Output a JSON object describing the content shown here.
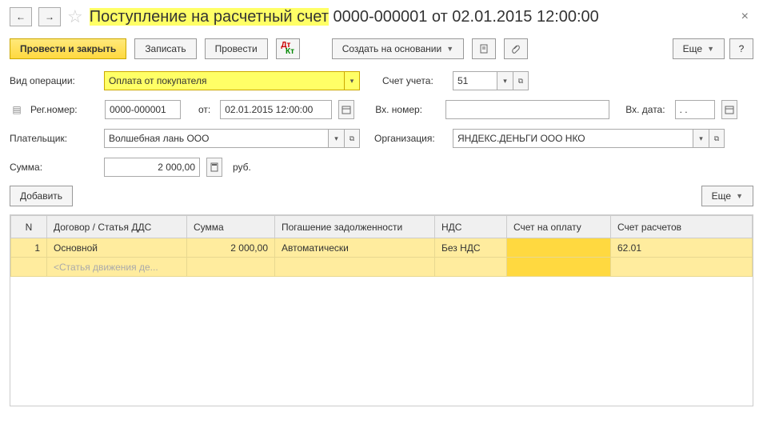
{
  "header": {
    "title_hl": "Поступление на расчетный счет",
    "title_rest": " 0000-000001 от 02.01.2015 12:00:00"
  },
  "toolbar": {
    "post_close": "Провести и закрыть",
    "save": "Записать",
    "post": "Провести",
    "create_based": "Создать на основании",
    "more": "Еще",
    "help": "?"
  },
  "fields": {
    "op_type_lbl": "Вид операции:",
    "op_type_val": "Оплата от покупателя",
    "account_lbl": "Счет учета:",
    "account_val": "51",
    "reg_no_lbl": "Рег.номер:",
    "reg_no_val": "0000-000001",
    "from_lbl": "от:",
    "from_val": "02.01.2015 12:00:00",
    "in_no_lbl": "Вх. номер:",
    "in_no_val": "",
    "in_date_lbl": "Вх. дата:",
    "in_date_val": ". .",
    "payer_lbl": "Плательщик:",
    "payer_val": "Волшебная лань ООО",
    "org_lbl": "Организация:",
    "org_val": "ЯНДЕКС.ДЕНЬГИ ООО НКО",
    "sum_lbl": "Сумма:",
    "sum_val": "2 000,00",
    "currency": "руб."
  },
  "table_toolbar": {
    "add": "Добавить",
    "more": "Еще"
  },
  "grid": {
    "cols": [
      "N",
      "Договор / Статья ДДС",
      "Сумма",
      "Погашение задолженности",
      "НДС",
      "Счет на оплату",
      "Счет расчетов"
    ],
    "row": {
      "n": "1",
      "contract": "Основной",
      "contract_sub": "<Статья движения де...",
      "sum": "2 000,00",
      "repay": "Автоматически",
      "vat": "Без НДС",
      "invoice": "",
      "settle": "62.01"
    }
  }
}
